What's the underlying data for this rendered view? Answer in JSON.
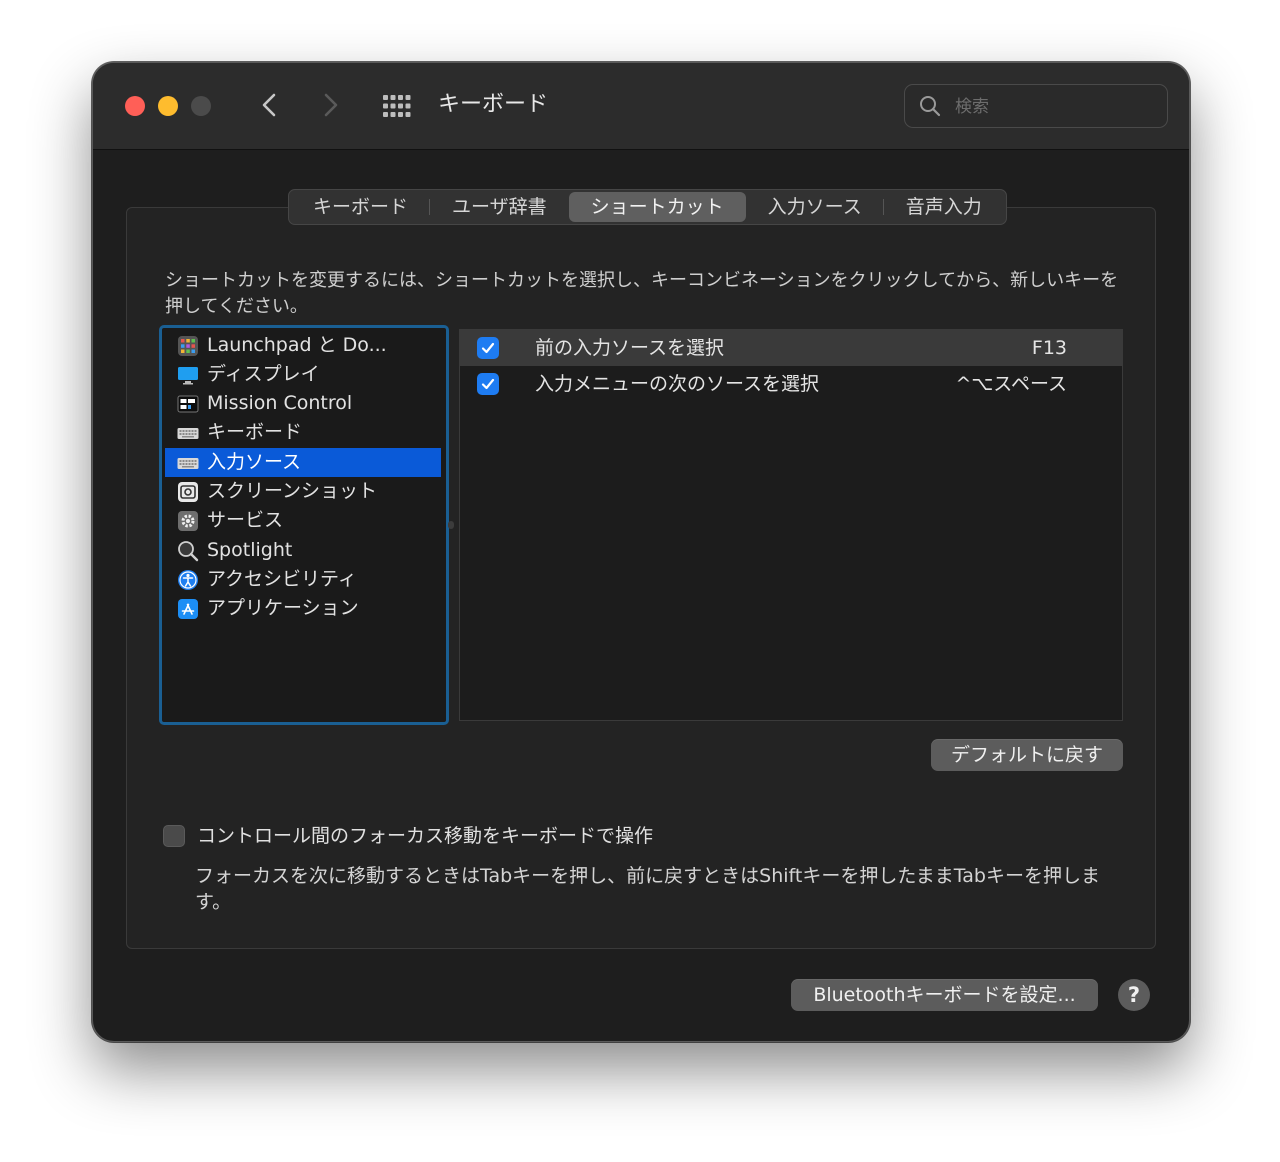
{
  "window": {
    "title": "キーボード",
    "search_placeholder": "検索"
  },
  "tabs": [
    {
      "label": "キーボード",
      "active": false
    },
    {
      "label": "ユーザ辞書",
      "active": false
    },
    {
      "label": "ショートカット",
      "active": true
    },
    {
      "label": "入力ソース",
      "active": false
    },
    {
      "label": "音声入力",
      "active": false
    }
  ],
  "description": "ショートカットを変更するには、ショートカットを選択し、キーコンビネーションをクリックしてから、新しいキーを押してください。",
  "sidebar": {
    "items": [
      {
        "label": "Launchpad と Do...",
        "icon": "launchpad-icon",
        "selected": false
      },
      {
        "label": "ディスプレイ",
        "icon": "display-icon",
        "selected": false
      },
      {
        "label": "Mission Control",
        "icon": "mission-control-icon",
        "selected": false
      },
      {
        "label": "キーボード",
        "icon": "keyboard-icon",
        "selected": false
      },
      {
        "label": "入力ソース",
        "icon": "keyboard-icon",
        "selected": true
      },
      {
        "label": "スクリーンショット",
        "icon": "screenshot-icon",
        "selected": false
      },
      {
        "label": "サービス",
        "icon": "gear-icon",
        "selected": false
      },
      {
        "label": "Spotlight",
        "icon": "magnifier-icon",
        "selected": false
      },
      {
        "label": "アクセシビリティ",
        "icon": "accessibility-icon",
        "selected": false
      },
      {
        "label": "アプリケーション",
        "icon": "app-store-icon",
        "selected": false
      }
    ]
  },
  "shortcuts": [
    {
      "label": "前の入力ソースを選択",
      "key": "F13",
      "checked": true,
      "selected": true
    },
    {
      "label": "入力メニューの次のソースを選択",
      "key": "^⌥スペース",
      "checked": true,
      "selected": false
    }
  ],
  "buttons": {
    "restore_defaults": "デフォルトに戻す",
    "bluetooth": "Bluetoothキーボードを設定...",
    "help": "?"
  },
  "focus": {
    "label": "コントロール間のフォーカス移動をキーボードで操作",
    "checked": false,
    "description": "フォーカスを次に移動するときはTabキーを押し、前に戻すときはShiftキーを押したままTabキーを押します。"
  },
  "colors": {
    "accent": "#0a5ad8",
    "checkbox": "#1e7cf2",
    "sidebar_focus_ring": "#1a5f93"
  }
}
